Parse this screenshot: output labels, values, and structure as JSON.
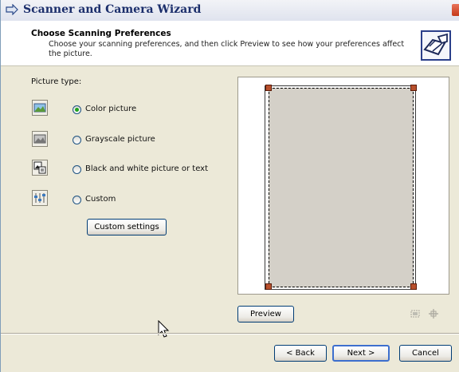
{
  "window": {
    "title": "Scanner and Camera Wizard"
  },
  "header": {
    "title": "Choose Scanning Preferences",
    "subtitle": "Choose your scanning preferences, and then click Preview to see how your preferences affect the picture."
  },
  "picture_type": {
    "label": "Picture type:",
    "options": [
      {
        "label": "Color picture",
        "selected": true,
        "icon": "color-picture-icon"
      },
      {
        "label": "Grayscale picture",
        "selected": false,
        "icon": "grayscale-picture-icon"
      },
      {
        "label": "Black and white picture or text",
        "selected": false,
        "icon": "bw-picture-icon"
      },
      {
        "label": "Custom",
        "selected": false,
        "icon": "custom-icon"
      }
    ],
    "custom_settings_label": "Custom settings"
  },
  "preview": {
    "button_label": "Preview"
  },
  "footer": {
    "back_label": "< Back",
    "next_label": "Next >",
    "cancel_label": "Cancel"
  },
  "colors": {
    "title_text": "#1b2e6b",
    "radio_selected": "#1ea31e",
    "scan_area": "#d4d0c8",
    "handle": "#b8502c"
  }
}
